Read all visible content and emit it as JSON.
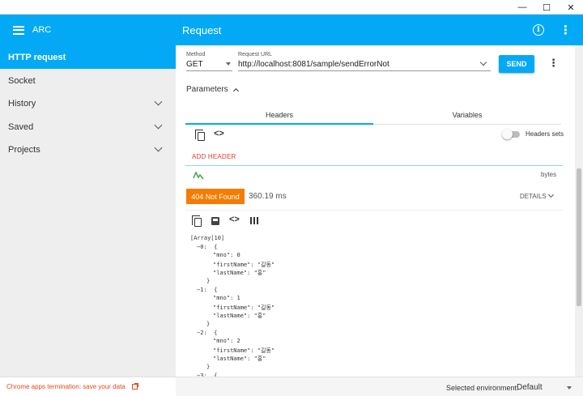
{
  "window": {
    "minimize_glyph": "—",
    "maximize_glyph": "☐",
    "close_glyph": "✕"
  },
  "appbar": {
    "app_name": "ARC",
    "page_title": "Request",
    "info_icon_glyph": "i",
    "more_glyph": "⋮",
    "accent_color": "#03a9f4"
  },
  "sidebar": {
    "items": [
      {
        "label": "HTTP request",
        "active": true
      },
      {
        "label": "Socket"
      },
      {
        "label": "History"
      },
      {
        "label": "Saved"
      },
      {
        "label": "Projects"
      }
    ]
  },
  "request": {
    "method_label": "Method",
    "method_value": "GET",
    "url_label": "Request URL",
    "url_value": "http://localhost:8081/sample/sendErrorNot",
    "send_label": "SEND",
    "more_glyph": "⋮",
    "parameters_label": "Parameters",
    "tabs": [
      {
        "label": "Headers",
        "selected": true
      },
      {
        "label": "Variables"
      }
    ],
    "code_glyph": "<>",
    "headers_sets_label": "Headers sets",
    "add_header_label": "ADD HEADER",
    "bytes_label": "bytes"
  },
  "response": {
    "status_text": "404 Not Found",
    "status_color": "#f57c00",
    "timing": "360.19 ms",
    "details_label": "DETAILS",
    "code_glyph": "<>",
    "json_lines": [
      {
        "indent": 0,
        "text": "[Array[10]"
      },
      {
        "indent": 1,
        "text": "−0:  {"
      },
      {
        "indent": 3,
        "text": "\"mno\": 0"
      },
      {
        "indent": 3,
        "text": "\"firstName\": \"길동\""
      },
      {
        "indent": 3,
        "text": "\"lastName\": \"홍\""
      },
      {
        "indent": 2,
        "text": "}"
      },
      {
        "indent": 1,
        "text": "−1:  {"
      },
      {
        "indent": 3,
        "text": "\"mno\": 1"
      },
      {
        "indent": 3,
        "text": "\"firstName\": \"길동\""
      },
      {
        "indent": 3,
        "text": "\"lastName\": \"홍\""
      },
      {
        "indent": 2,
        "text": "}"
      },
      {
        "indent": 1,
        "text": "−2:  {"
      },
      {
        "indent": 3,
        "text": "\"mno\": 2"
      },
      {
        "indent": 3,
        "text": "\"firstName\": \"길동\""
      },
      {
        "indent": 3,
        "text": "\"lastName\": \"홍\""
      },
      {
        "indent": 2,
        "text": "}"
      },
      {
        "indent": 1,
        "text": "−3:  {"
      }
    ]
  },
  "footer": {
    "termination_link": "Chrome apps termination: save your data",
    "env_label": "Selected environment:",
    "env_value": "Default"
  }
}
